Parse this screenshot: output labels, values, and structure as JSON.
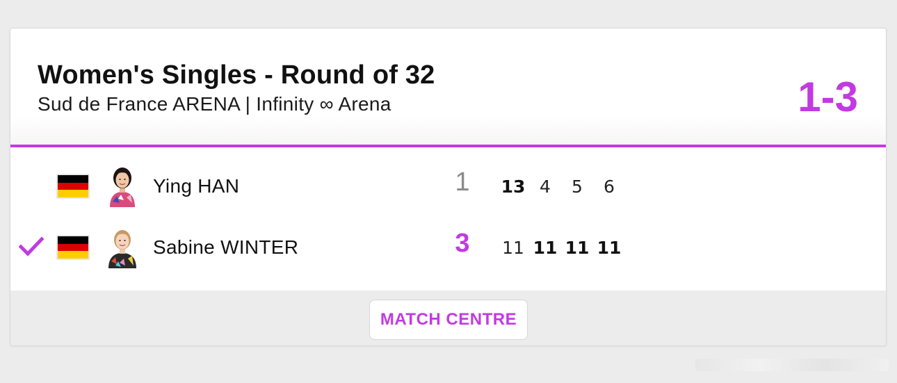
{
  "match": {
    "title": "Women's Singles - Round of 32",
    "venue": "Sud de France ARENA | Infinity ∞ Arena",
    "overall_score": "1-3"
  },
  "colors": {
    "accent": "#c23ae2",
    "flag_black": "#000000",
    "flag_red": "#dd0000",
    "flag_gold": "#ffce00"
  },
  "players": [
    {
      "name": "Ying HAN",
      "country_flag": "germany-flag",
      "sets_won": "1",
      "winner": false,
      "games": [
        "13",
        "4",
        "5",
        "6"
      ],
      "games_won": [
        true,
        false,
        false,
        false
      ]
    },
    {
      "name": "Sabine WINTER",
      "country_flag": "germany-flag",
      "sets_won": "3",
      "winner": true,
      "games": [
        "11",
        "11",
        "11",
        "11"
      ],
      "games_won": [
        false,
        true,
        true,
        true
      ]
    }
  ],
  "footer": {
    "match_centre_label": "MATCH CENTRE"
  },
  "icons": {
    "winner_marker": "checkmark-icon"
  }
}
